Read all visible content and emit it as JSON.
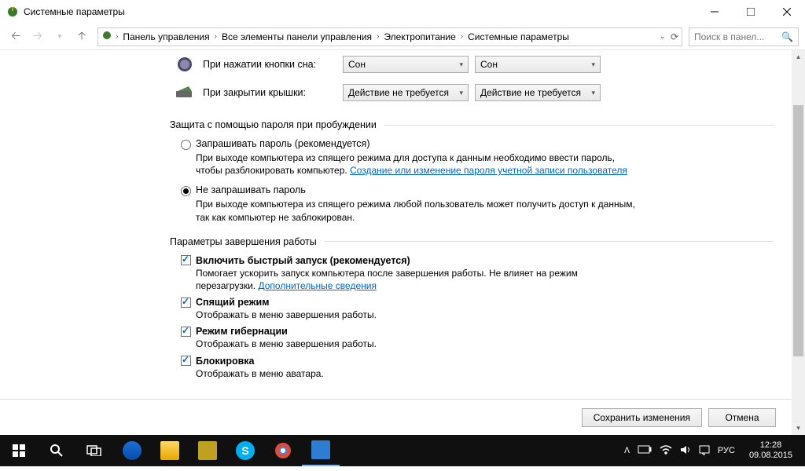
{
  "window": {
    "title": "Системные параметры"
  },
  "breadcrumb": [
    "Панель управления",
    "Все элементы панели управления",
    "Электропитание",
    "Системные параметры"
  ],
  "search": {
    "placeholder": "Поиск в панел..."
  },
  "options": {
    "sleep_button": {
      "label": "При нажатии кнопки сна:",
      "battery": "Сон",
      "plugged": "Сон"
    },
    "lid_close": {
      "label": "При закрытии крышки:",
      "battery": "Действие не требуется",
      "plugged": "Действие не требуется"
    }
  },
  "password_section": {
    "title": "Защита с помощью пароля при пробуждении",
    "require": {
      "label": "Запрашивать пароль (рекомендуется)",
      "desc_pre": "При выходе компьютера из спящего режима для доступа к данным необходимо ввести пароль, чтобы разблокировать компьютер. ",
      "link": "Создание или изменение пароля учетной записи пользователя"
    },
    "norequire": {
      "label": "Не запрашивать пароль",
      "desc": "При выходе компьютера из спящего режима любой пользователь может получить доступ к данным, так как компьютер не заблокирован."
    }
  },
  "shutdown_section": {
    "title": "Параметры завершения работы",
    "fast": {
      "label": "Включить быстрый запуск (рекомендуется)",
      "desc_pre": "Помогает ускорить запуск компьютера после завершения работы. Не влияет на режим перезагрузки. ",
      "link": "Дополнительные сведения"
    },
    "sleep": {
      "label": "Спящий режим",
      "desc": "Отображать в меню завершения работы."
    },
    "hibernate": {
      "label": "Режим гибернации",
      "desc": "Отображать в меню завершения работы."
    },
    "lock": {
      "label": "Блокировка",
      "desc": "Отображать в меню аватара."
    }
  },
  "buttons": {
    "save": "Сохранить изменения",
    "cancel": "Отмена"
  },
  "tray": {
    "lang": "РУС",
    "time": "12:28",
    "date": "09.08.2015"
  }
}
